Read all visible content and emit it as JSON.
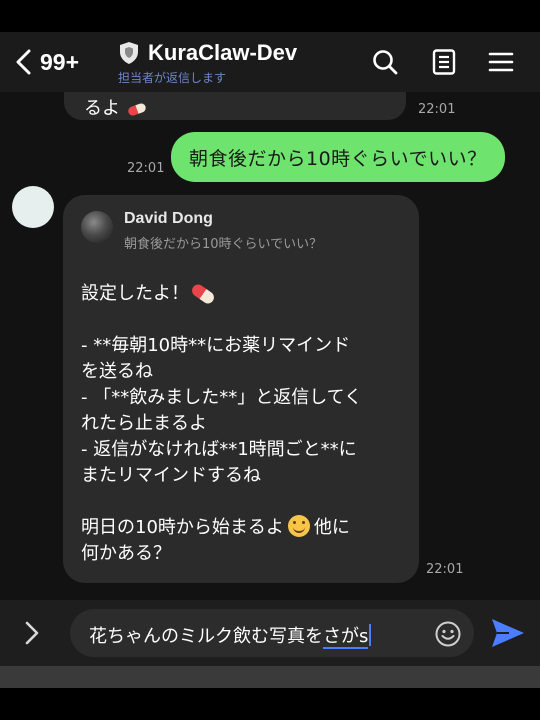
{
  "header": {
    "badge_count": "99+",
    "title": "KuraClaw-Dev",
    "subtitle": "担当者が返信します",
    "icons": [
      "chevron-left-icon",
      "shield-icon",
      "search-icon",
      "note-icon",
      "menu-icon"
    ]
  },
  "messages": {
    "prev_partial": {
      "text": "るよ",
      "time": "22:01"
    },
    "outgoing": {
      "text": "朝食後だから10時ぐらいでいい？",
      "time": "22:01"
    },
    "incoming": {
      "reply_name": "David Dong",
      "reply_quote": "朝食後だから10時ぐらいでいい？",
      "line1": "設定したよ！",
      "body": "- **毎朝10時**にお薬リマインド\nを送るね\n- 「**飲みました**」と返信してく\nれたら止まるよ\n- 返信がなければ**1時間ごと**に\nまたリマインドするね",
      "closing_a": "明日の10時から始まるよ",
      "closing_b": "他に",
      "closing_c": "何かある？",
      "time": "22:01"
    }
  },
  "input": {
    "value_plain": "花ちゃんのミルク飲む写真を",
    "value_composing": "さがs"
  },
  "colors": {
    "outgoing_bubble": "#6ee36d",
    "incoming_bubble": "#2b2b2b",
    "accent_blue": "#4a7dff",
    "subtitle_blue": "#6e86c9"
  }
}
